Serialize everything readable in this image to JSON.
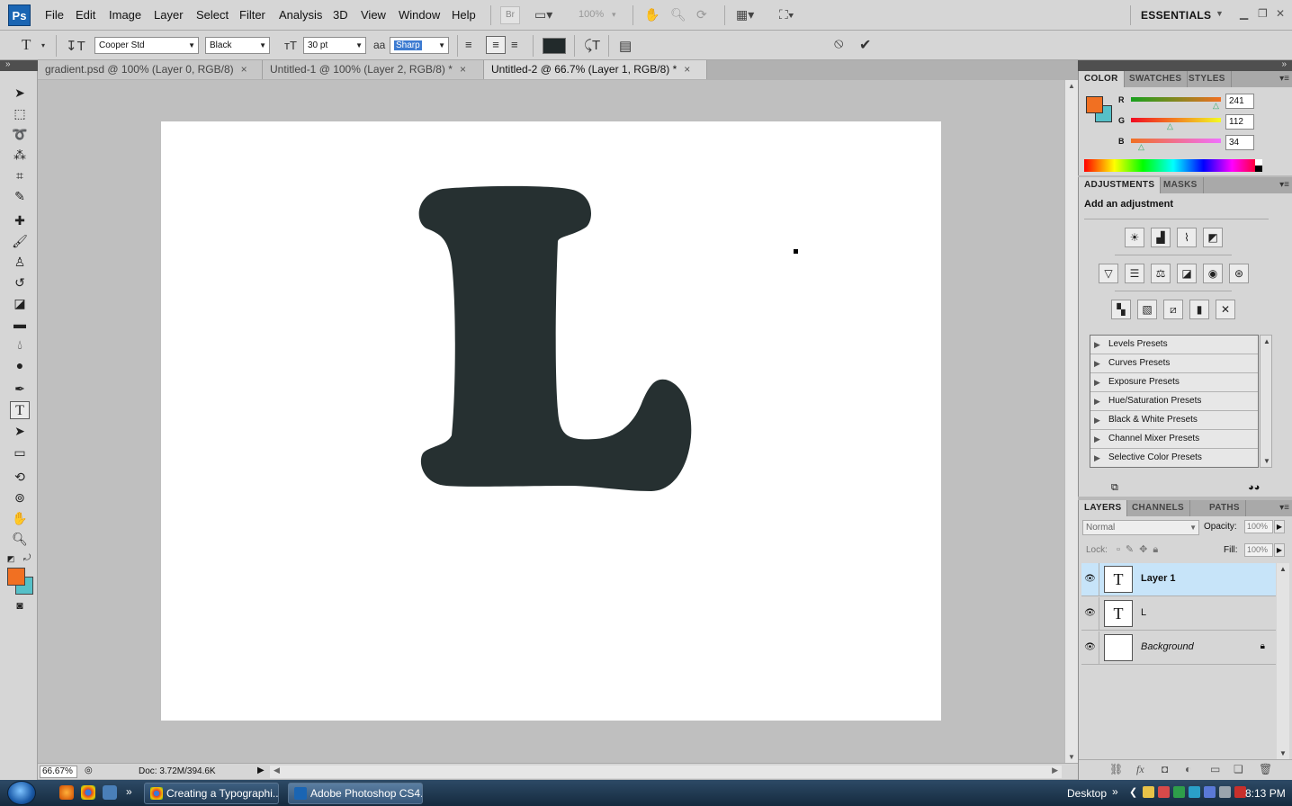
{
  "app": {
    "logo": "Ps",
    "menu": [
      "File",
      "Edit",
      "Image",
      "Layer",
      "Select",
      "Filter",
      "Analysis",
      "3D",
      "View",
      "Window",
      "Help"
    ],
    "bridge_label": "Br",
    "zoom_select": "100%",
    "workspace": "ESSENTIALS"
  },
  "options": {
    "font_family": "Cooper Std",
    "font_style": "Black",
    "font_size": "30 pt",
    "antialias": "Sharp",
    "text_color": "#222a2b"
  },
  "tabs": [
    {
      "label": "gradient.psd @ 100% (Layer 0, RGB/8)",
      "close": "×"
    },
    {
      "label": "Untitled-1 @ 100% (Layer 2, RGB/8) *",
      "close": "×"
    },
    {
      "label": "Untitled-2 @ 66.7% (Layer 1, RGB/8) *",
      "close": "×"
    }
  ],
  "tools": {
    "foreground": "#f17022",
    "background": "#56c0c8",
    "active": "type-tool"
  },
  "status": {
    "zoom": "66.67%",
    "doc": "Doc: 3.72M/394.6K"
  },
  "color_panel": {
    "tabs": [
      "COLOR",
      "SWATCHES",
      "STYLES"
    ],
    "channels": [
      {
        "name": "R",
        "value": "241"
      },
      {
        "name": "G",
        "value": "112"
      },
      {
        "name": "B",
        "value": "34"
      }
    ]
  },
  "adjustments_panel": {
    "tabs": [
      "ADJUSTMENTS",
      "MASKS"
    ],
    "title": "Add an adjustment",
    "presets": [
      "Levels Presets",
      "Curves Presets",
      "Exposure Presets",
      "Hue/Saturation Presets",
      "Black & White Presets",
      "Channel Mixer Presets",
      "Selective Color Presets"
    ]
  },
  "layers_panel": {
    "tabs": [
      "LAYERS",
      "CHANNELS",
      "PATHS"
    ],
    "blend_mode": "Normal",
    "opacity_label": "Opacity:",
    "opacity": "100%",
    "lock_label": "Lock:",
    "fill_label": "Fill:",
    "fill": "100%",
    "layers": [
      {
        "name": "Layer 1",
        "thumb": "T"
      },
      {
        "name": "L",
        "thumb": "T"
      },
      {
        "name": "Background",
        "thumb": ""
      }
    ]
  },
  "taskbar": {
    "buttons": [
      "Creating a Typographi...",
      "Adobe Photoshop CS4..."
    ],
    "desktop": "Desktop",
    "time": "8:13 PM"
  }
}
